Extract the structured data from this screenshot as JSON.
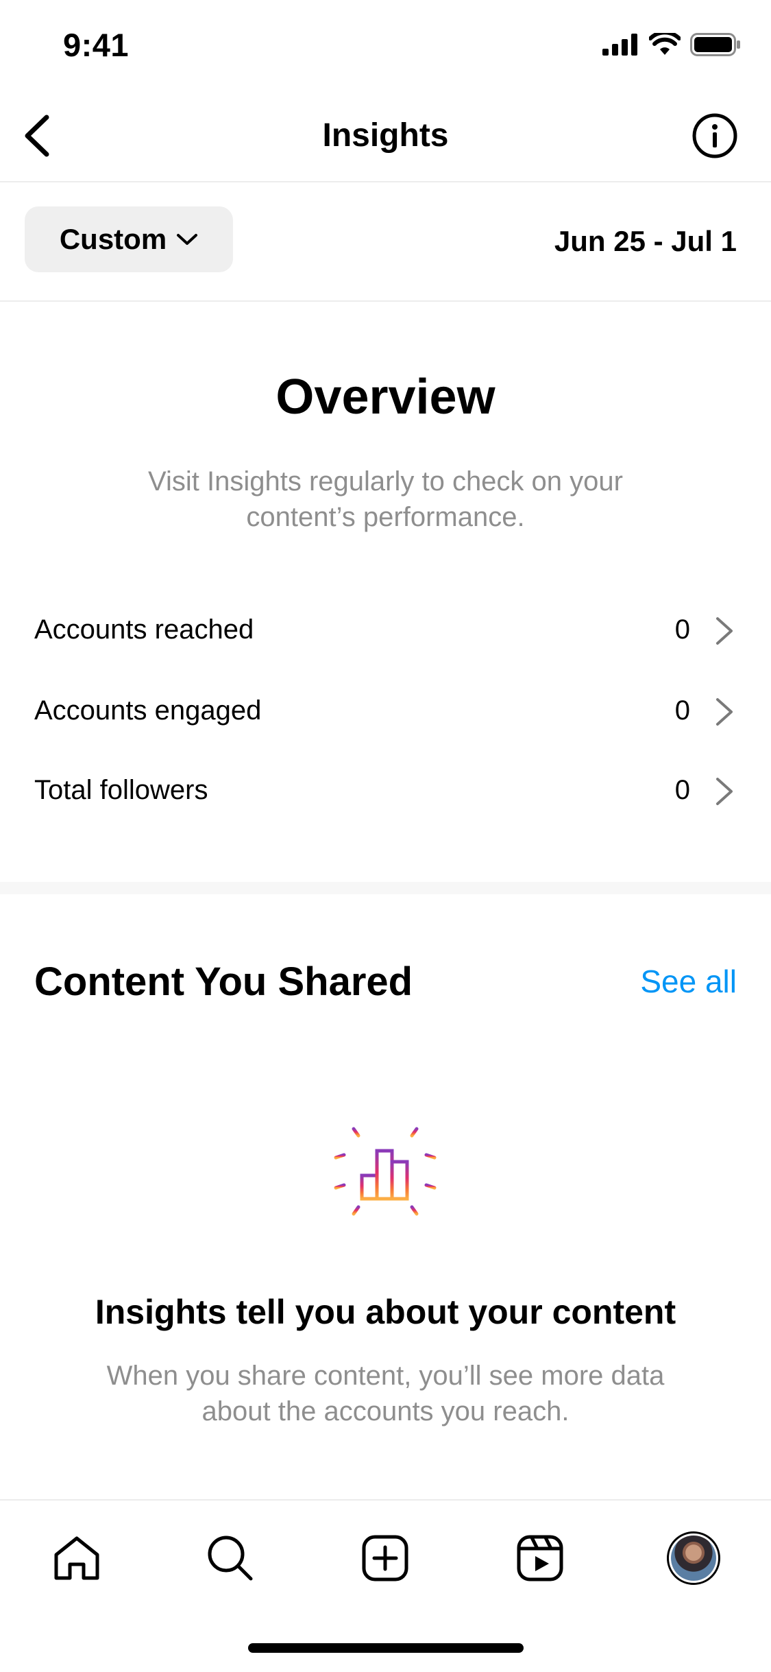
{
  "status_bar": {
    "time": "9:41",
    "icons": [
      "cellular-signal-icon",
      "wifi-icon",
      "battery-icon"
    ]
  },
  "nav": {
    "title": "Insights",
    "back_icon": "chevron-left-icon",
    "info_icon": "info-icon"
  },
  "filter": {
    "period_label": "Custom",
    "date_range": "Jun 25 - Jul 1"
  },
  "overview": {
    "title": "Overview",
    "subtitle": "Visit Insights regularly to check on your content’s performance.",
    "metrics": [
      {
        "label": "Accounts reached",
        "value": "0"
      },
      {
        "label": "Accounts engaged",
        "value": "0"
      },
      {
        "label": "Total followers",
        "value": "0"
      }
    ]
  },
  "content": {
    "title": "Content You Shared",
    "see_all": "See all",
    "empty_title": "Insights tell you about your content",
    "empty_subtitle": "When you share content, you’ll see more data about the accounts you reach.",
    "empty_icon": "bar-chart-sparkle-icon"
  },
  "tab_bar": {
    "tabs": [
      "home-icon",
      "search-icon",
      "create-icon",
      "reels-icon",
      "profile-avatar"
    ]
  },
  "colors": {
    "accent_link": "#0095f6",
    "secondary_text": "#8e8e8e",
    "button_bg": "#efefef",
    "gradient": [
      "#8a3ab9",
      "#e1306c",
      "#f77737",
      "#fcaf45"
    ]
  }
}
